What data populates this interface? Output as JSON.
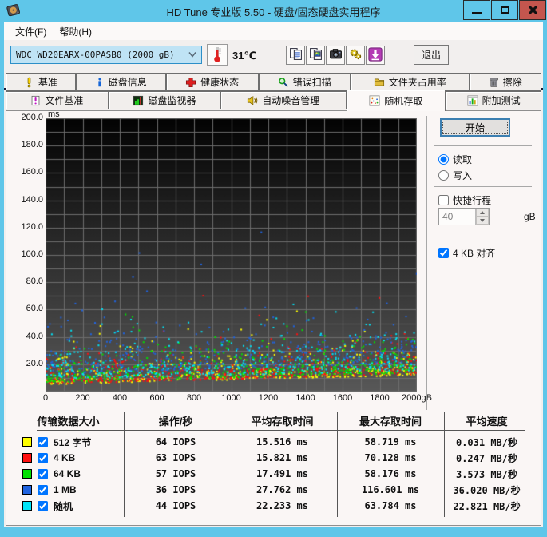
{
  "window": {
    "title": "HD Tune 专业版 5.50 - 硬盘/固态硬盘实用程序"
  },
  "menu": {
    "items": [
      "文件(F)",
      "帮助(H)"
    ]
  },
  "toolbar": {
    "drive_selector": {
      "value": "WDC WD20EARX-00PASB0 (2000 gB)"
    },
    "temperature": "31℃",
    "exit_label": "退出"
  },
  "tabs": {
    "row1": [
      {
        "id": "benchmark",
        "label": "基准",
        "icon": "exclamation"
      },
      {
        "id": "disk-info",
        "label": "磁盘信息",
        "icon": "info"
      },
      {
        "id": "health",
        "label": "健康状态",
        "icon": "health-cross"
      },
      {
        "id": "error-scan",
        "label": "错误扫描",
        "icon": "magnifier"
      },
      {
        "id": "folder-usage",
        "label": "文件夹占用率",
        "icon": "folder"
      },
      {
        "id": "erase",
        "label": "擦除",
        "icon": "trash"
      }
    ],
    "row2": [
      {
        "id": "file-benchmark",
        "label": "文件基准",
        "icon": "file-benchmark"
      },
      {
        "id": "disk-monitor",
        "label": "磁盘监视器",
        "icon": "disk-monitor"
      },
      {
        "id": "aam",
        "label": "自动噪音管理",
        "icon": "speaker"
      },
      {
        "id": "random-access",
        "label": "随机存取",
        "icon": "scatter",
        "active": true
      },
      {
        "id": "extra-tests",
        "label": "附加测试",
        "icon": "extra-tests"
      }
    ]
  },
  "side_panel": {
    "start_label": "开始",
    "read_label": "读取",
    "read_selected": true,
    "write_label": "写入",
    "write_selected": false,
    "short_stroke_label": "快捷行程",
    "short_stroke_checked": false,
    "short_stroke_value": "40",
    "short_stroke_unit": "gB",
    "align_label": "4 KB 对齐",
    "align_checked": true
  },
  "chart_data": {
    "type": "scatter",
    "title": "随机存取 access time vs position",
    "ylabel_unit": "ms",
    "xlabel_unit": "gB",
    "xlim": [
      0,
      2000
    ],
    "ylim": [
      0,
      200
    ],
    "x_ticks": [
      "0",
      "200",
      "400",
      "600",
      "800",
      "1000",
      "1200",
      "1400",
      "1600",
      "1800",
      "2000gB"
    ],
    "y_ticks": [
      "200.0",
      "180.0",
      "160.0",
      "140.0",
      "120.0",
      "100.0",
      "80.0",
      "60.0",
      "40.0",
      "20.0"
    ],
    "grid": {
      "x_step": 100,
      "y_step": 10,
      "color": "#6d6d6d"
    },
    "background": {
      "top": "#030303",
      "bottom": "#585858"
    },
    "seed": 20130550,
    "series": [
      {
        "name": "512 字节",
        "color": "#ffff00",
        "iops": 64,
        "avg_access_ms": 15.516,
        "max_access_ms": 58.719,
        "avg_speed": "0.031 MB/秒",
        "scatter": {
          "count": 500,
          "env0": 5,
          "env1": 12,
          "mean_above": 7,
          "outlier_rate": 0.004,
          "outlier_min": 30
        }
      },
      {
        "name": "4 KB",
        "color": "#ff1010",
        "iops": 63,
        "avg_access_ms": 15.821,
        "max_access_ms": 70.128,
        "avg_speed": "0.247 MB/秒",
        "scatter": {
          "count": 500,
          "env0": 5.5,
          "env1": 12.5,
          "mean_above": 6.8,
          "outlier_rate": 0.004,
          "outlier_min": 30
        }
      },
      {
        "name": "64 KB",
        "color": "#00e000",
        "iops": 57,
        "avg_access_ms": 17.491,
        "max_access_ms": 58.176,
        "avg_speed": "3.573 MB/秒",
        "scatter": {
          "count": 500,
          "env0": 6.5,
          "env1": 13.5,
          "mean_above": 7.5,
          "outlier_rate": 0.005,
          "outlier_min": 30
        }
      },
      {
        "name": "1 MB",
        "color": "#2064e0",
        "iops": 36,
        "avg_access_ms": 27.762,
        "max_access_ms": 116.601,
        "avg_speed": "36.020 MB/秒",
        "scatter": {
          "count": 400,
          "env0": 13,
          "env1": 20,
          "mean_above": 11.5,
          "outlier_rate": 0.012,
          "outlier_min": 40
        }
      },
      {
        "name": "随机",
        "color": "#00e4f8",
        "iops": 44,
        "avg_access_ms": 22.233,
        "max_access_ms": 63.784,
        "avg_speed": "22.821 MB/秒",
        "scatter": {
          "count": 430,
          "env0": 9,
          "env1": 15,
          "mean_above": 10,
          "outlier_rate": 0.008,
          "outlier_min": 35
        }
      }
    ]
  },
  "table": {
    "headers": [
      "传输数据大小",
      "操作/秒",
      "平均存取时间",
      "最大存取时间",
      "平均速度"
    ],
    "rows": [
      {
        "color": "#ffff00",
        "checked": true,
        "label": "512 字节",
        "cells": [
          "64 IOPS",
          "15.516 ms",
          "58.719 ms",
          "0.031 MB/秒"
        ]
      },
      {
        "color": "#ff1010",
        "checked": true,
        "label": "4 KB",
        "cells": [
          "63 IOPS",
          "15.821 ms",
          "70.128 ms",
          "0.247 MB/秒"
        ]
      },
      {
        "color": "#00e000",
        "checked": true,
        "label": "64 KB",
        "cells": [
          "57 IOPS",
          "17.491 ms",
          "58.176 ms",
          "3.573 MB/秒"
        ]
      },
      {
        "color": "#2064e0",
        "checked": true,
        "label": "1 MB",
        "cells": [
          "36 IOPS",
          "27.762 ms",
          "116.601 ms",
          "36.020 MB/秒"
        ]
      },
      {
        "color": "#00e4f8",
        "checked": true,
        "label": "随机",
        "cells": [
          "44 IOPS",
          "22.233 ms",
          "63.784 ms",
          "22.821 MB/秒"
        ]
      }
    ]
  }
}
